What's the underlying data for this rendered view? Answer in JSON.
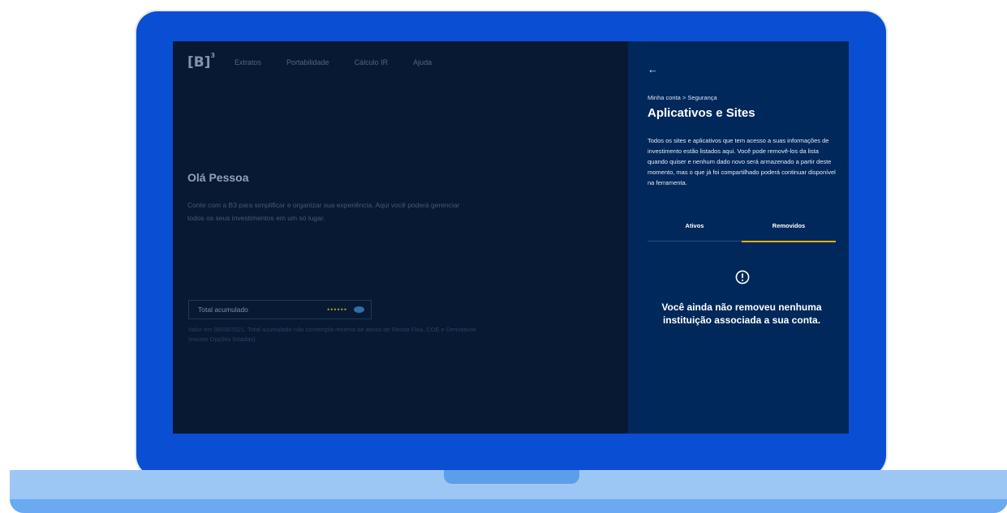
{
  "dashboard": {
    "logo": "[B]",
    "logo_sup": "3",
    "nav": [
      "Extratos",
      "Portabilidade",
      "Cálculo IR",
      "Ajuda"
    ],
    "greeting": "Olá Pessoa",
    "intro": "Conte com a B3 para simplificar e organizar sua experiência. Aqui você poderá gerenciar todos os seus investimentos em um só lugar.",
    "total_label": "Total acumulado",
    "total_value": "••••••",
    "footnote": "Valor em 06/09/2021. Total acumulado não contempla reserva de ativos de Renda Fixa, COE e Derivativos (exceto Opções listadas)."
  },
  "panel": {
    "breadcrumb": "Minha conta > Segurança",
    "title": "Aplicativos e Sites",
    "description": "Todos os sites e aplicativos que tem acesso a suas informações de investimento estão listados aqui. Você pode removê-los da lista quando quiser e nenhum dado novo será armazenado a partir deste momento, mas o que já foi compartilhado poderá continuar disponível na ferramenta.",
    "tabs": [
      {
        "label": "Ativos",
        "active": false
      },
      {
        "label": "Removidos",
        "active": true
      }
    ],
    "empty_message": "Você ainda não removeu nenhuma instituição associada a sua conta."
  },
  "colors": {
    "laptop_frame": "#0a4fd3",
    "panel_bg": "#01285a",
    "tab_indicator": "#f2b100"
  }
}
